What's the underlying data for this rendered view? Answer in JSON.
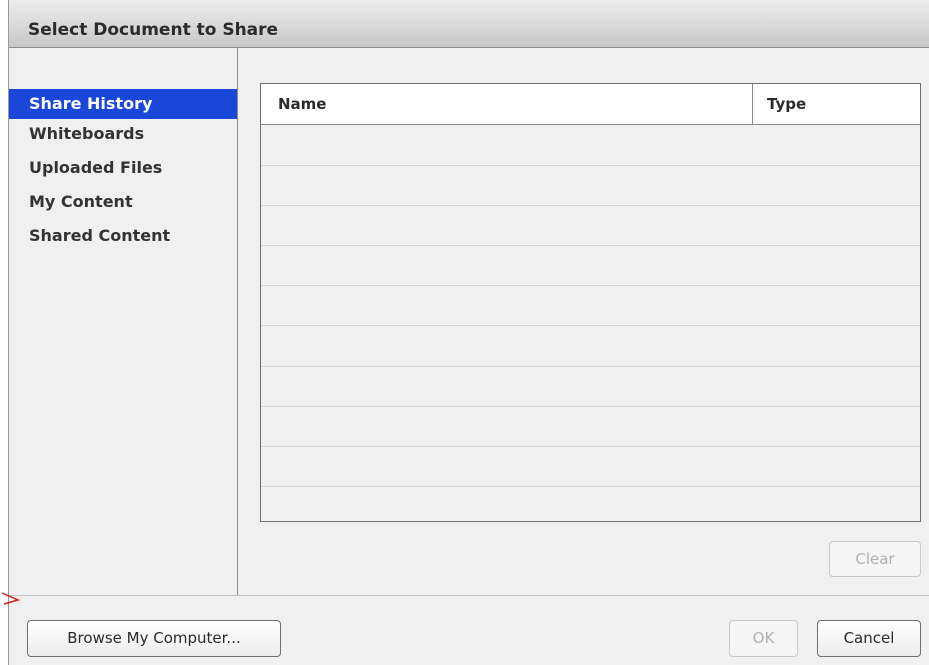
{
  "window": {
    "title": "Select Document to Share"
  },
  "sidebar": {
    "items": [
      {
        "label": "Share History",
        "selected": true
      },
      {
        "label": "Whiteboards",
        "selected": false
      },
      {
        "label": "Uploaded Files",
        "selected": false
      },
      {
        "label": "My Content",
        "selected": false
      },
      {
        "label": "Shared Content",
        "selected": false
      }
    ]
  },
  "table": {
    "columns": [
      "Name",
      "Type"
    ],
    "rows": []
  },
  "buttons": {
    "clear": {
      "label": "Clear",
      "enabled": false
    },
    "browse": {
      "label": "Browse My Computer...",
      "enabled": true
    },
    "ok": {
      "label": "OK",
      "enabled": false
    },
    "cancel": {
      "label": "Cancel",
      "enabled": true
    }
  },
  "colors": {
    "selection": "#1a47d9",
    "disabled_text": "#b0b0b0",
    "annotation_mark": "#cc2222"
  }
}
